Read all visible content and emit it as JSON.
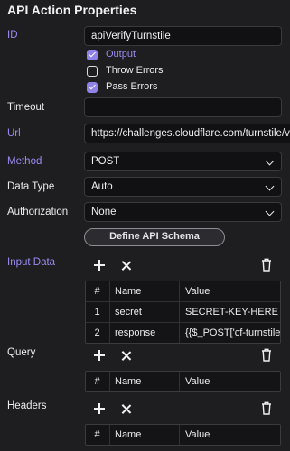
{
  "panel": {
    "title": "API Action Properties"
  },
  "fields": {
    "id": {
      "label": "ID",
      "value": "apiVerifyTurnstile"
    },
    "options": [
      {
        "label": "Output",
        "checked": true
      },
      {
        "label": "Throw Errors",
        "checked": false
      },
      {
        "label": "Pass Errors",
        "checked": true
      }
    ],
    "timeout": {
      "label": "Timeout",
      "value": ""
    },
    "url": {
      "label": "Url",
      "value": "https://challenges.cloudflare.com/turnstile/v"
    },
    "method": {
      "label": "Method",
      "value": "POST"
    },
    "data_type": {
      "label": "Data Type",
      "value": "Auto"
    },
    "authorization": {
      "label": "Authorization",
      "value": "None"
    }
  },
  "define_schema_button": "Define API Schema",
  "sections": {
    "input_data": {
      "label": "Input Data",
      "columns": [
        "#",
        "Name",
        "Value"
      ],
      "rows": [
        {
          "num": "1",
          "name": "secret",
          "value": "SECRET-KEY-HERE"
        },
        {
          "num": "2",
          "name": "response",
          "value": "{{$_POST['cf-turnstile-response']}}"
        }
      ]
    },
    "query": {
      "label": "Query",
      "columns": [
        "#",
        "Name",
        "Value"
      ]
    },
    "headers": {
      "label": "Headers",
      "columns": [
        "#",
        "Name",
        "Value"
      ]
    }
  },
  "colors": {
    "accent": "#9b8cf2",
    "checkbox": "#8f82e8",
    "background": "#1e1e20"
  }
}
